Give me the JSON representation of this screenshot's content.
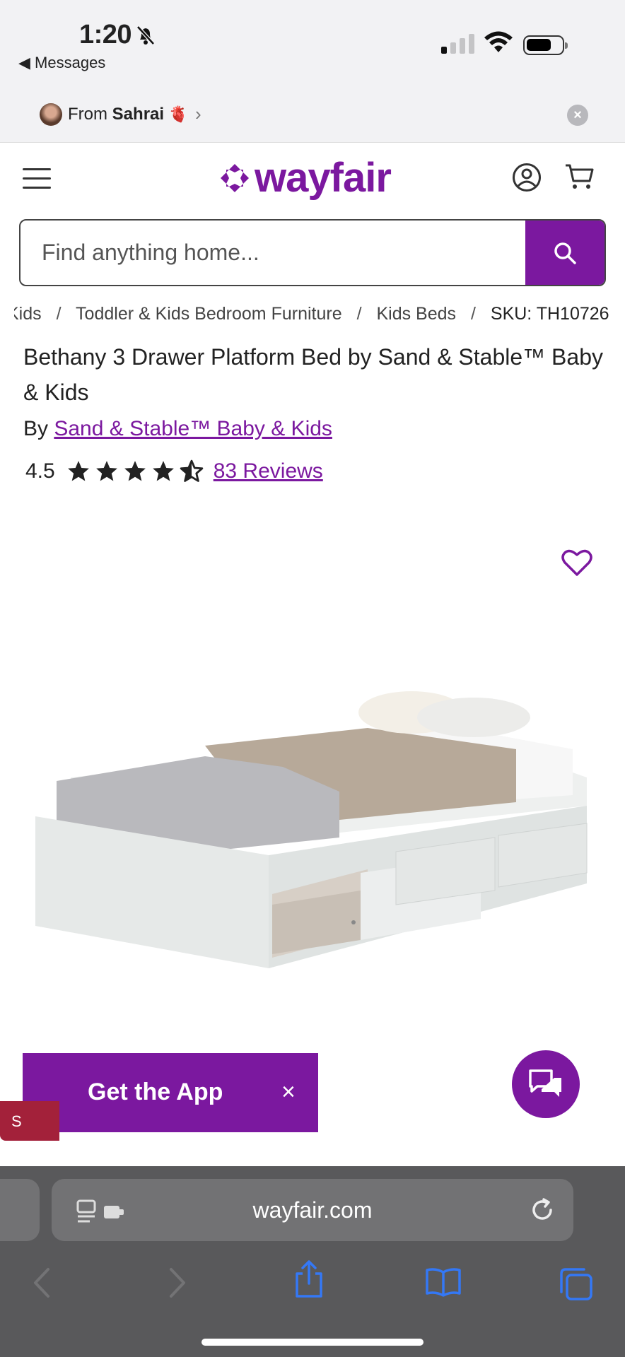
{
  "status_bar": {
    "time": "1:20",
    "back_label": "◀ Messages"
  },
  "shared_banner": {
    "from_prefix": "From",
    "from_name": "Sahrai",
    "emoji": "🫀",
    "chevron": "›",
    "close": "×"
  },
  "header": {
    "logo_text": "wayfair",
    "icons": [
      "menu-icon",
      "account-icon",
      "cart-icon"
    ]
  },
  "search": {
    "placeholder": "Find anything home...",
    "value": ""
  },
  "breadcrumb": {
    "items": [
      "Kids",
      "Toddler & Kids Bedroom Furniture",
      "Kids Beds"
    ],
    "separator": "/",
    "sku": "SKU: TH10726"
  },
  "product": {
    "title": "Bethany 3 Drawer Platform Bed by Sand & Stable™ Baby & Kids",
    "by_prefix": "By",
    "brand": "Sand & Stable™ Baby & Kids",
    "rating_value": "4.5",
    "rating_stars": 4.5,
    "reviews_label": "83 Reviews"
  },
  "promo": {
    "get_app_label": "Get the App",
    "get_app_close": "×",
    "sale_tab_label": "S"
  },
  "browser": {
    "url": "wayfair.com"
  },
  "colors": {
    "brand": "#7b189f",
    "sale": "#a3213a",
    "safari_bar": "#59595b",
    "safari_icons": "#3478f6"
  }
}
